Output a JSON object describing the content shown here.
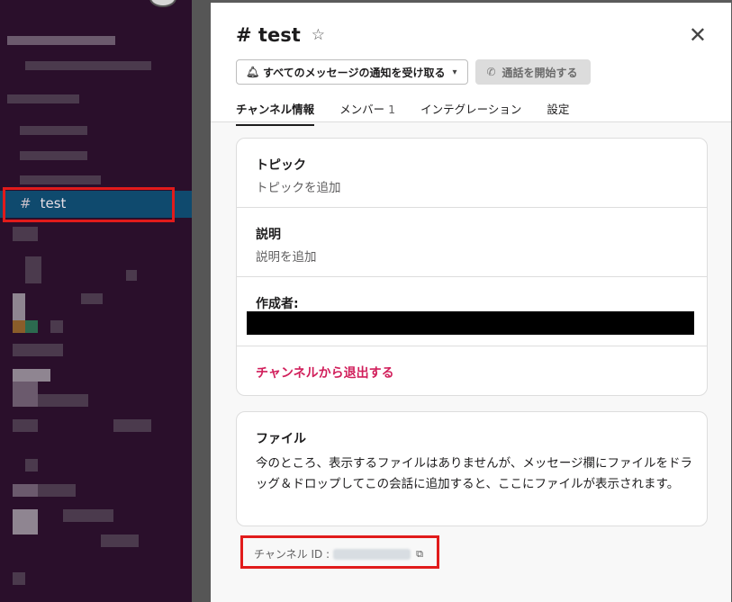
{
  "sidebar": {
    "selected_channel": {
      "hash": "#",
      "label": "test"
    }
  },
  "panel": {
    "title": "# test",
    "star_icon": "star-outline-icon",
    "close_icon": "close-icon",
    "notify_button": {
      "label": "すべてのメッセージの通知を受け取る",
      "icon": "bell-icon",
      "chevron": "chevron-down-icon"
    },
    "call_button": {
      "label": "通話を開始する",
      "icon": "phone-icon"
    },
    "tabs": [
      {
        "label": "チャンネル情報",
        "active": true
      },
      {
        "label": "メンバー",
        "count": "1"
      },
      {
        "label": "インテグレーション"
      },
      {
        "label": "設定"
      }
    ],
    "topic": {
      "title": "トピック",
      "placeholder": "トピックを追加"
    },
    "description": {
      "title": "説明",
      "placeholder": "説明を追加"
    },
    "creator": {
      "title": "作成者:"
    },
    "leave_link": "チャンネルから退出する",
    "files": {
      "title": "ファイル",
      "body": "今のところ、表示するファイルはありませんが、メッセージ欄にファイルをドラッグ＆ドロップしてこの会話に追加すると、ここにファイルが表示されます。"
    },
    "channel_id_label": "チャンネル ID :"
  },
  "colors": {
    "sidebar_bg": "#2a0f2b",
    "selected_bg": "#0f4a6e",
    "highlight_red": "#e11b1b",
    "leave_link": "#d11f5b"
  }
}
